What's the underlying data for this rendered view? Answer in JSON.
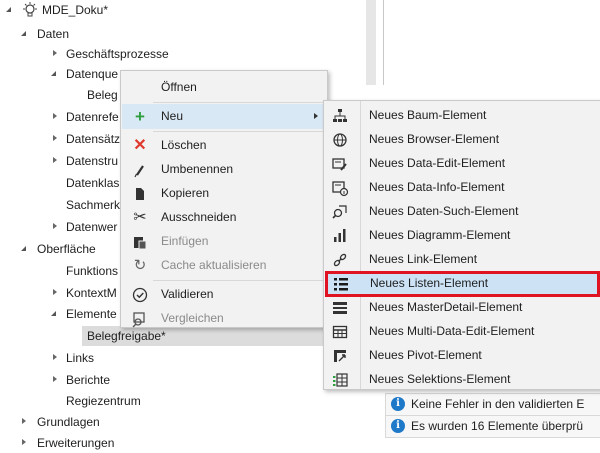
{
  "tree": {
    "root_label": "MDE_Doku*",
    "daten": "Daten",
    "geschaeftsprozesse": "Geschäftsprozesse",
    "datenquellen": "Datenque",
    "belegt": "Beleg",
    "datenreferenzen": "Datenrefe",
    "datensaetze": "Datensätz",
    "datenstrukturen": "Datenstru",
    "datenklassen": "Datenklas",
    "sachmerkmale": "Sachmerk",
    "datenwerte": "Datenwer",
    "oberflaeche": "Oberfläche",
    "funktionen": "Funktions",
    "kontextmenue": "KontextM",
    "elemente": "Elemente",
    "belegfreigabe": "Belegfreigabe*",
    "links": "Links",
    "berichte": "Berichte",
    "regiezentrum": "Regiezentrum",
    "grundlagen": "Grundlagen",
    "erweiterungen": "Erweiterungen"
  },
  "context_menu": {
    "items": [
      {
        "label": "Öffnen",
        "icon": "none",
        "disabled": false
      },
      {
        "label": "Neu",
        "icon": "plus-icon",
        "disabled": false,
        "has_submenu": true
      },
      {
        "label": "Löschen",
        "icon": "delete-x-icon",
        "disabled": false
      },
      {
        "label": "Umbenennen",
        "icon": "pencil-icon",
        "disabled": false
      },
      {
        "label": "Kopieren",
        "icon": "copy-icon",
        "disabled": false
      },
      {
        "label": "Ausschneiden",
        "icon": "scissors-icon",
        "disabled": false
      },
      {
        "label": "Einfügen",
        "icon": "paste-icon",
        "disabled": true
      },
      {
        "label": "Cache aktualisieren",
        "icon": "refresh-icon",
        "disabled": true
      },
      {
        "label": "Validieren",
        "icon": "check-circle-icon",
        "disabled": false
      },
      {
        "label": "Vergleichen",
        "icon": "compare-icon",
        "disabled": true
      }
    ]
  },
  "submenu": {
    "items": [
      {
        "label": "Neues Baum-Element",
        "icon": "tree-hierarchy-icon"
      },
      {
        "label": "Neues Browser-Element",
        "icon": "globe-icon"
      },
      {
        "label": "Neues Data-Edit-Element",
        "icon": "form-edit-icon"
      },
      {
        "label": "Neues Data-Info-Element",
        "icon": "form-info-icon"
      },
      {
        "label": "Neues Daten-Such-Element",
        "icon": "data-search-icon"
      },
      {
        "label": "Neues Diagramm-Element",
        "icon": "bar-chart-icon"
      },
      {
        "label": "Neues Link-Element",
        "icon": "link-icon"
      },
      {
        "label": "Neues Listen-Element",
        "icon": "list-icon",
        "highlighted": true
      },
      {
        "label": "Neues MasterDetail-Element",
        "icon": "master-detail-icon"
      },
      {
        "label": "Neues Multi-Data-Edit-Element",
        "icon": "grid-icon"
      },
      {
        "label": "Neues Pivot-Element",
        "icon": "pivot-icon"
      },
      {
        "label": "Neues Selektions-Element",
        "icon": "selection-grid-icon"
      }
    ]
  },
  "messages": [
    {
      "text": "Keine Fehler in den validierten E",
      "icon": "info-icon"
    },
    {
      "text": "Es wurden 16 Elemente überprü",
      "icon": "info-icon"
    }
  ],
  "colors": {
    "highlight_red": "#e01323",
    "highlight_blue": "#cde3f5",
    "plus_green": "#2f9e3f",
    "delete_red": "#e0382c",
    "info_blue": "#1e79c8"
  }
}
